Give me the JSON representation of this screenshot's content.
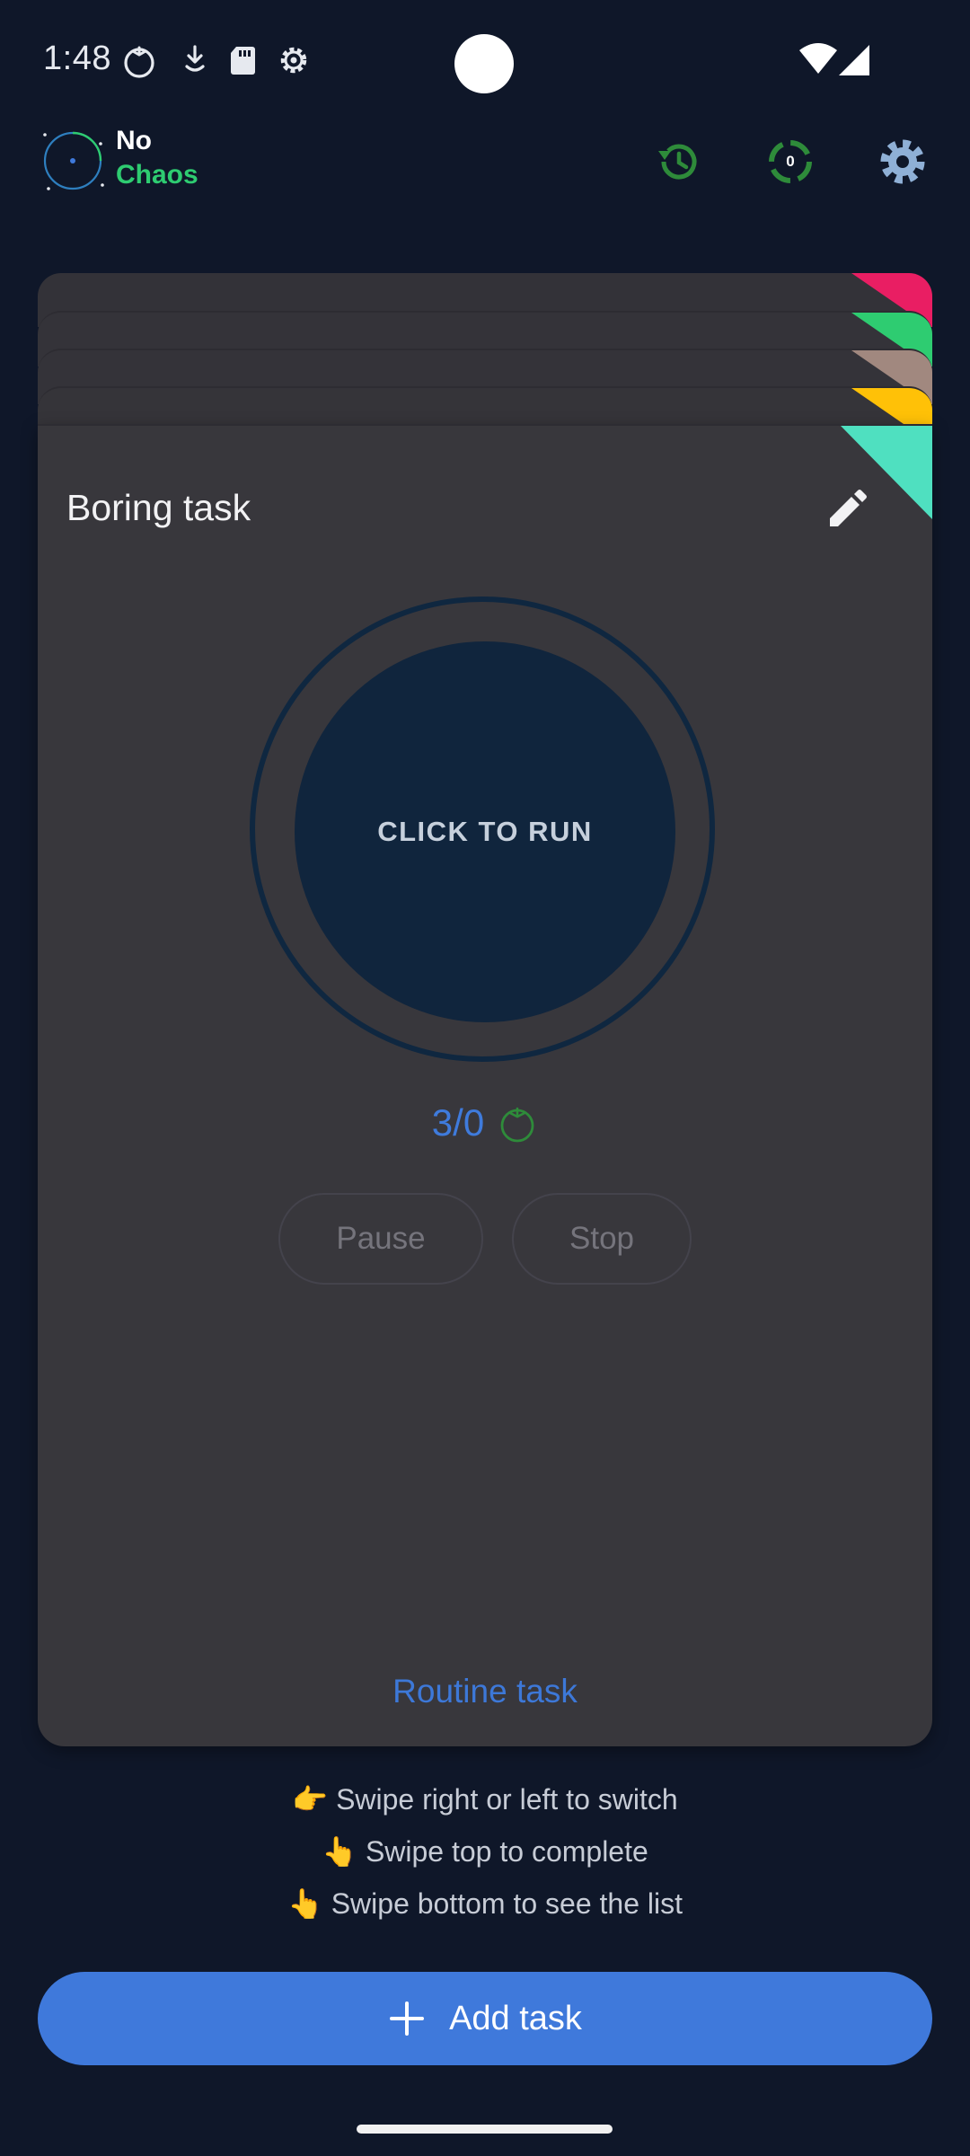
{
  "status_bar": {
    "time": "1:48",
    "icons": [
      "tomato-notification-icon",
      "download-icon",
      "sd-card-icon",
      "settings-gear-notification-icon",
      "wifi-icon",
      "signal-icon"
    ]
  },
  "header": {
    "app_name_line1": "No",
    "app_name_line2": "Chaos",
    "counter_value": "0",
    "colors": {
      "accent_green": "#2ecc71",
      "icon_green": "#2e8b3a",
      "settings_icon": "#8fb0d6"
    }
  },
  "stack_tab_colors": [
    "#e91e63",
    "#2ecc71",
    "#a1887f",
    "#ffc107",
    "#4fe0c0"
  ],
  "card": {
    "title": "Boring task",
    "run_label": "CLICK TO RUN",
    "pomodoro_count": "3/0",
    "pause_label": "Pause",
    "stop_label": "Stop",
    "task_type": "Routine task"
  },
  "hints": [
    {
      "emoji": "👉",
      "text": "Swipe right or left to switch"
    },
    {
      "emoji": "👆",
      "text": "Swipe top to complete"
    },
    {
      "emoji": "👆",
      "text": "Swipe bottom to see the list"
    }
  ],
  "add_task": {
    "label": "Add task"
  }
}
